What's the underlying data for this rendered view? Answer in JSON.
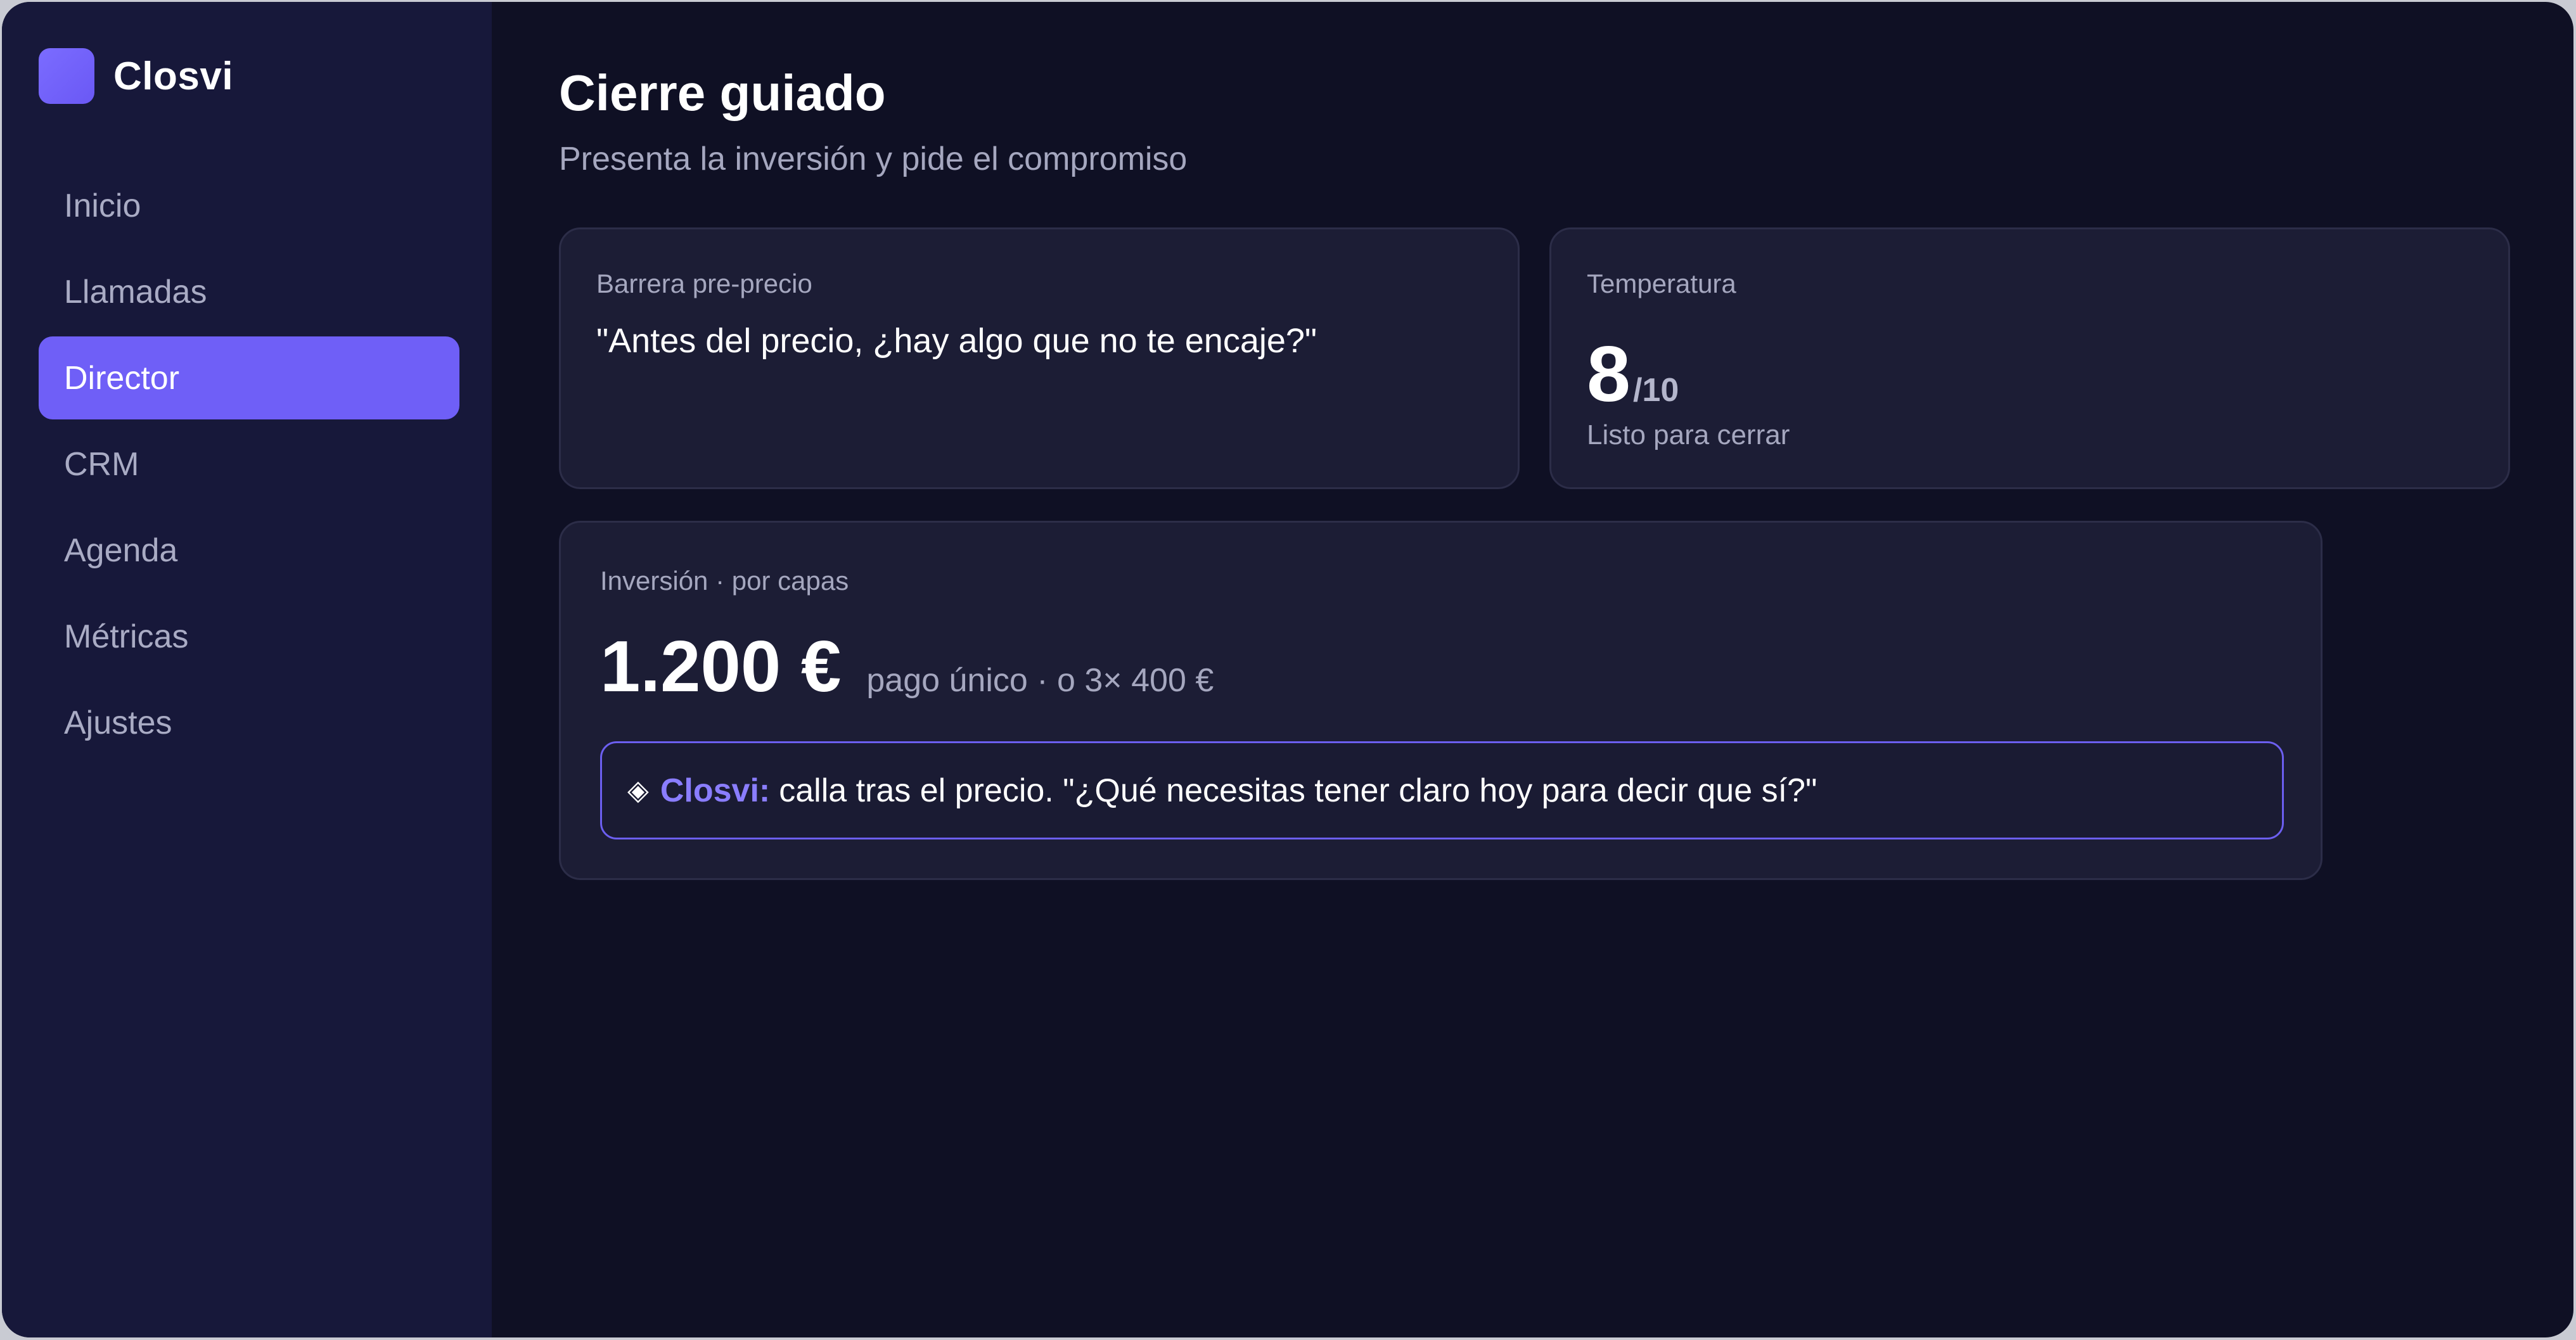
{
  "brand": {
    "name": "Closvi"
  },
  "nav": {
    "items": [
      {
        "label": "Inicio"
      },
      {
        "label": "Llamadas"
      },
      {
        "label": "Director"
      },
      {
        "label": "CRM"
      },
      {
        "label": "Agenda"
      },
      {
        "label": "Métricas"
      },
      {
        "label": "Ajustes"
      }
    ],
    "active": "Director"
  },
  "header": {
    "title": "Cierre guiado",
    "subtitle": "Presenta la inversión y pide el compromiso"
  },
  "barrier_card": {
    "label": "Barrera pre-precio",
    "quote": "\"Antes del precio, ¿hay algo que no te encaje?\""
  },
  "temperature_card": {
    "label": "Temperatura",
    "value": "8",
    "max": "/10",
    "status": "Listo para cerrar"
  },
  "investment_card": {
    "label": "Inversión · por capas",
    "price": "1.200 €",
    "terms": "pago único · o 3× 400 €",
    "tip": {
      "icon": "◈",
      "name": "Closvi:",
      "text": "calla tras el precio. \"¿Qué necesitas tener claro hoy para decir que sí?\""
    }
  },
  "colors": {
    "accent": "#6f5ff7",
    "sidebar_bg": "#17183a",
    "main_bg": "#0f1024",
    "card_bg": "#1c1d35"
  },
  "icons": {
    "brand": "closvi-logo-icon",
    "tip": "diamond-icon"
  }
}
